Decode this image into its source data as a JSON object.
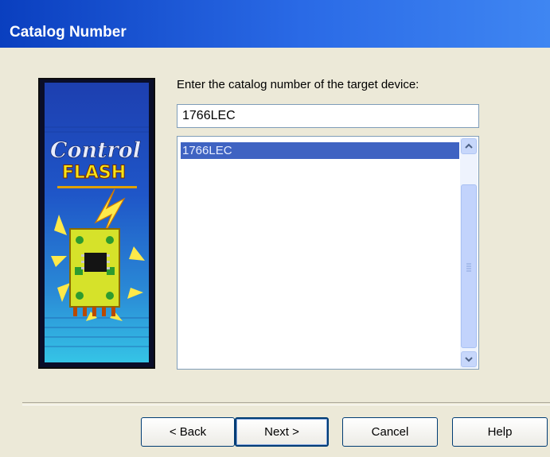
{
  "window": {
    "title": "Catalog Number"
  },
  "logo": {
    "line1": "Control",
    "line2": "FLASH"
  },
  "form": {
    "prompt": "Enter the catalog number of the target device:",
    "catalog_value": "1766LEC",
    "list_items": [
      "1766LEC"
    ]
  },
  "buttons": {
    "back": "< Back",
    "next": "Next >",
    "cancel": "Cancel",
    "help": "Help"
  },
  "colors": {
    "titlebar": "#2a6ae6",
    "selection": "#3f63c2",
    "dialog_bg": "#ece9d8"
  }
}
